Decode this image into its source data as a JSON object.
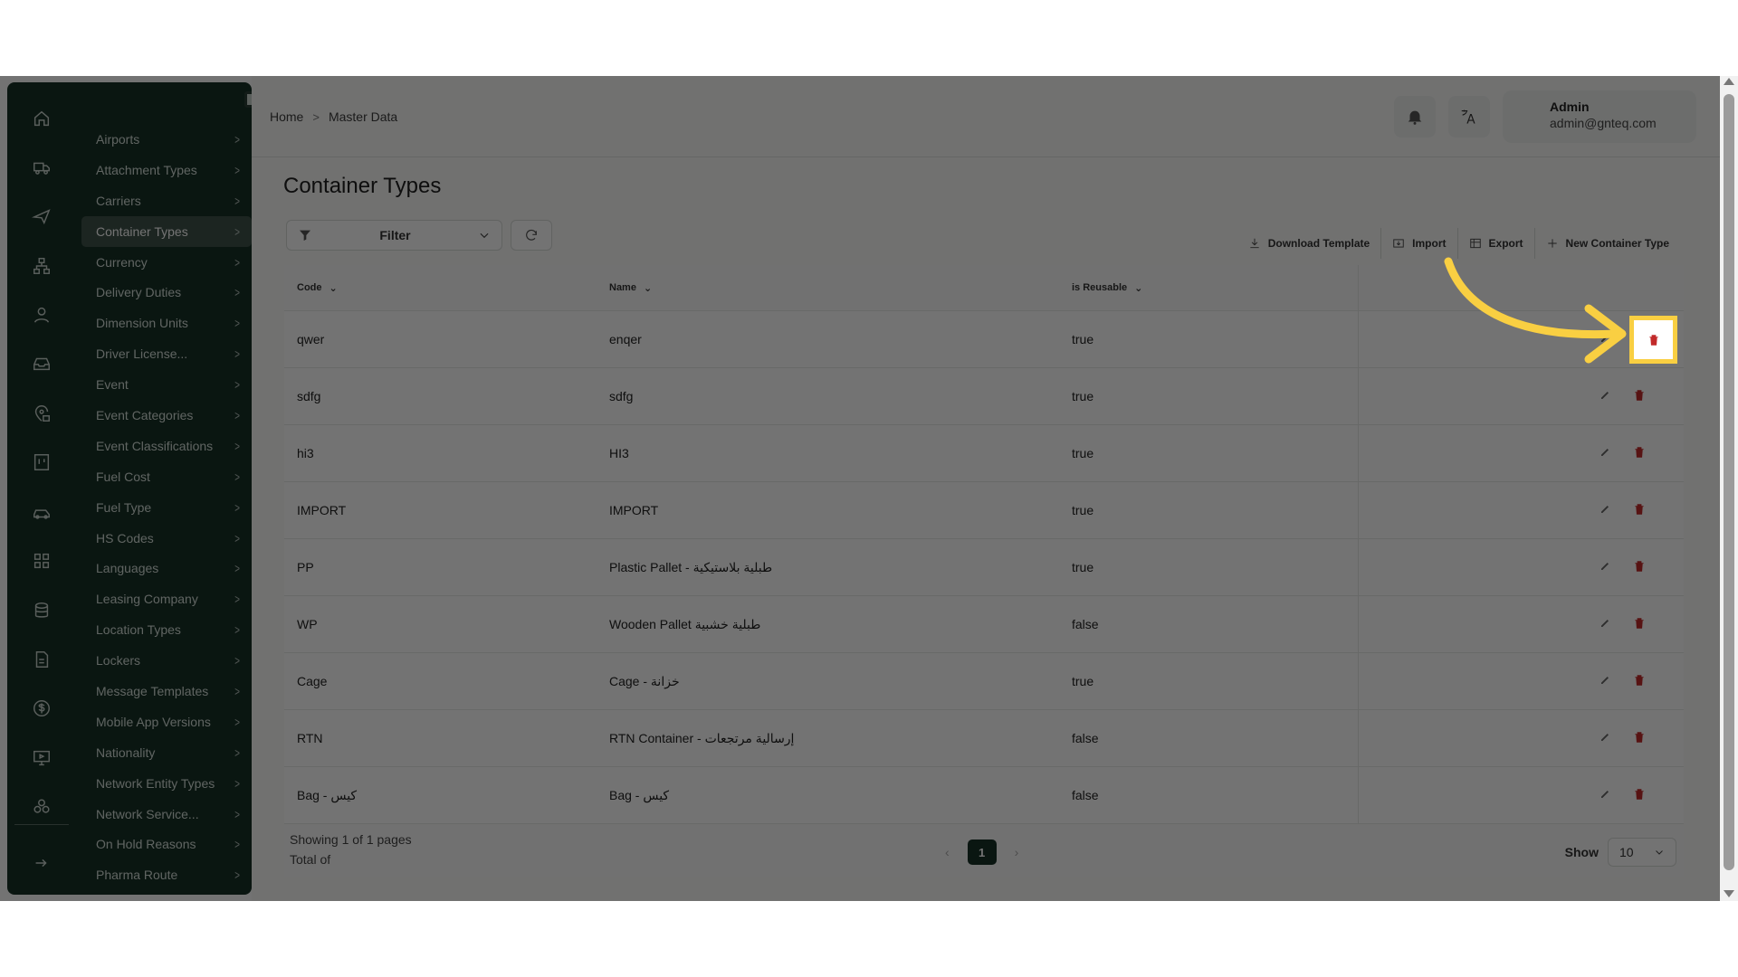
{
  "sidebar": {
    "menu": [
      {
        "label": "Airports"
      },
      {
        "label": "Attachment Types"
      },
      {
        "label": "Carriers"
      },
      {
        "label": "Container Types",
        "active": true
      },
      {
        "label": "Currency"
      },
      {
        "label": "Delivery Duties"
      },
      {
        "label": "Dimension Units"
      },
      {
        "label": "Driver License..."
      },
      {
        "label": "Event"
      },
      {
        "label": "Event Categories"
      },
      {
        "label": "Event Classifications"
      },
      {
        "label": "Fuel Cost"
      },
      {
        "label": "Fuel Type"
      },
      {
        "label": "HS Codes"
      },
      {
        "label": "Languages"
      },
      {
        "label": "Leasing Company"
      },
      {
        "label": "Location Types"
      },
      {
        "label": "Lockers"
      },
      {
        "label": "Message Templates"
      },
      {
        "label": "Mobile App Versions"
      },
      {
        "label": "Nationality"
      },
      {
        "label": "Network Entity Types"
      },
      {
        "label": "Network Service..."
      },
      {
        "label": "On Hold Reasons"
      },
      {
        "label": "Pharma Route"
      }
    ],
    "rail_icons": [
      "home-icon",
      "truck-icon",
      "plane-icon",
      "network-icon",
      "user-icon",
      "inbox-icon",
      "location-lock-icon",
      "board-icon",
      "car-icon",
      "grid-icon",
      "database-icon",
      "document-icon",
      "dollar-icon",
      "monitor-icon",
      "cubes-icon",
      "logout-icon"
    ]
  },
  "header": {
    "breadcrumb": [
      "Home",
      "Master Data"
    ],
    "user": {
      "name": "Admin",
      "email": "admin@gnteq.com"
    }
  },
  "page": {
    "title": "Container Types",
    "filter_label": "Filter",
    "actions": {
      "download": "Download Template",
      "import": "Import",
      "export": "Export",
      "new": "New Container Type"
    }
  },
  "table": {
    "columns": [
      "Code",
      "Name",
      "is Reusable"
    ],
    "rows": [
      {
        "code": "qwer",
        "name": "enqer",
        "reusable": "true"
      },
      {
        "code": "sdfg",
        "name": "sdfg",
        "reusable": "true"
      },
      {
        "code": "hi3",
        "name": "HI3",
        "reusable": "true"
      },
      {
        "code": "IMPORT",
        "name": "IMPORT",
        "reusable": "true"
      },
      {
        "code": "PP",
        "name": "Plastic Pallet - طبلية بلاستيكية",
        "reusable": "true"
      },
      {
        "code": "WP",
        "name": "Wooden Pallet طبلية خشبية",
        "reusable": "false"
      },
      {
        "code": "Cage",
        "name": "Cage - خزانة",
        "reusable": "true"
      },
      {
        "code": "RTN",
        "name": "RTN Container - إرسالية مرتجعات",
        "reusable": "false"
      },
      {
        "code": "Bag - كيس",
        "name": "Bag - كيس",
        "reusable": "false"
      }
    ]
  },
  "footer": {
    "showing": "Showing 1 of 1 pages",
    "total": "Total of",
    "current_page": "1",
    "show_label": "Show",
    "page_size": "10"
  },
  "colors": {
    "accent": "#173127",
    "highlight": "#f9cf42",
    "delete": "#c22a2a"
  }
}
